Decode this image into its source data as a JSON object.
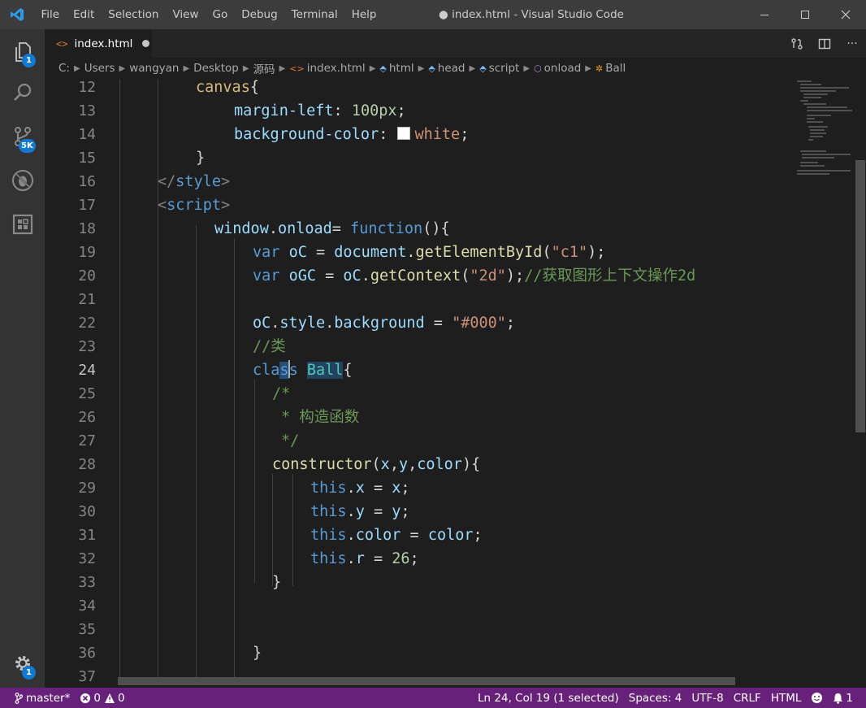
{
  "window": {
    "title": "● index.html - Visual Studio Code"
  },
  "menu": [
    "File",
    "Edit",
    "Selection",
    "View",
    "Go",
    "Debug",
    "Terminal",
    "Help"
  ],
  "activity_bar": {
    "explorer_badge": "1",
    "scm_badge": "5K",
    "settings_badge": "1"
  },
  "tab": {
    "label": "index.html"
  },
  "breadcrumb": {
    "items": [
      "C:",
      "Users",
      "wangyan",
      "Desktop",
      "源码",
      "index.html",
      "html",
      "head",
      "script",
      "onload",
      "Ball"
    ]
  },
  "editor": {
    "line_numbers": [
      "12",
      "13",
      "14",
      "15",
      "16",
      "17",
      "18",
      "19",
      "20",
      "21",
      "22",
      "23",
      "24",
      "25",
      "26",
      "27",
      "28",
      "29",
      "30",
      "31",
      "32",
      "33",
      "34",
      "35",
      "36",
      "37"
    ],
    "active_line": "24",
    "code": {
      "l12": [
        "canvas",
        "{"
      ],
      "l13": [
        "margin-left",
        ": ",
        "100px",
        ";"
      ],
      "l14": [
        "background-color",
        ": ",
        "white",
        ";"
      ],
      "l15": [
        "}"
      ],
      "l16": [
        "</",
        "style",
        ">"
      ],
      "l17": [
        "<",
        "script",
        ">"
      ],
      "l18": [
        "window",
        ".",
        "onload",
        "= ",
        "function",
        "(){"
      ],
      "l19": [
        "var",
        " ",
        "oC",
        " = ",
        "document",
        ".",
        "getElementById",
        "(",
        "\"c1\"",
        ");"
      ],
      "l20": [
        "var",
        " ",
        "oGC",
        " = ",
        "oC",
        ".",
        "getContext",
        "(",
        "\"2d\"",
        ");",
        "//获取图形上下文操作2d"
      ],
      "l22": [
        "oC",
        ".",
        "style",
        ".",
        "background",
        " = ",
        "\"#000\"",
        ";"
      ],
      "l23": [
        "//类"
      ],
      "l24": [
        "cla",
        "s",
        "s",
        " ",
        "Ball",
        "{"
      ],
      "l25": [
        "/*"
      ],
      "l26": [
        "* 构造函数"
      ],
      "l27": [
        "*/"
      ],
      "l28": [
        "constructor",
        "(",
        "x",
        ",",
        "y",
        ",",
        "color",
        "){"
      ],
      "l29": [
        "this",
        ".",
        "x",
        " = ",
        "x",
        ";"
      ],
      "l30": [
        "this",
        ".",
        "y",
        " = ",
        "y",
        ";"
      ],
      "l31": [
        "this",
        ".",
        "color",
        " = ",
        "color",
        ";"
      ],
      "l32": [
        "this",
        ".",
        "r",
        " = ",
        "26",
        ";"
      ],
      "l33": [
        "}"
      ],
      "l36": [
        "}"
      ]
    }
  },
  "status_bar": {
    "branch": "master*",
    "errors": "0",
    "warnings": "0",
    "position": "Ln 24, Col 19 (1 selected)",
    "spaces": "Spaces: 4",
    "encoding": "UTF-8",
    "eol": "CRLF",
    "language": "HTML",
    "notifications": "1"
  },
  "colors": {
    "statusbar": "#68217a",
    "accent": "#0e7ad3"
  }
}
